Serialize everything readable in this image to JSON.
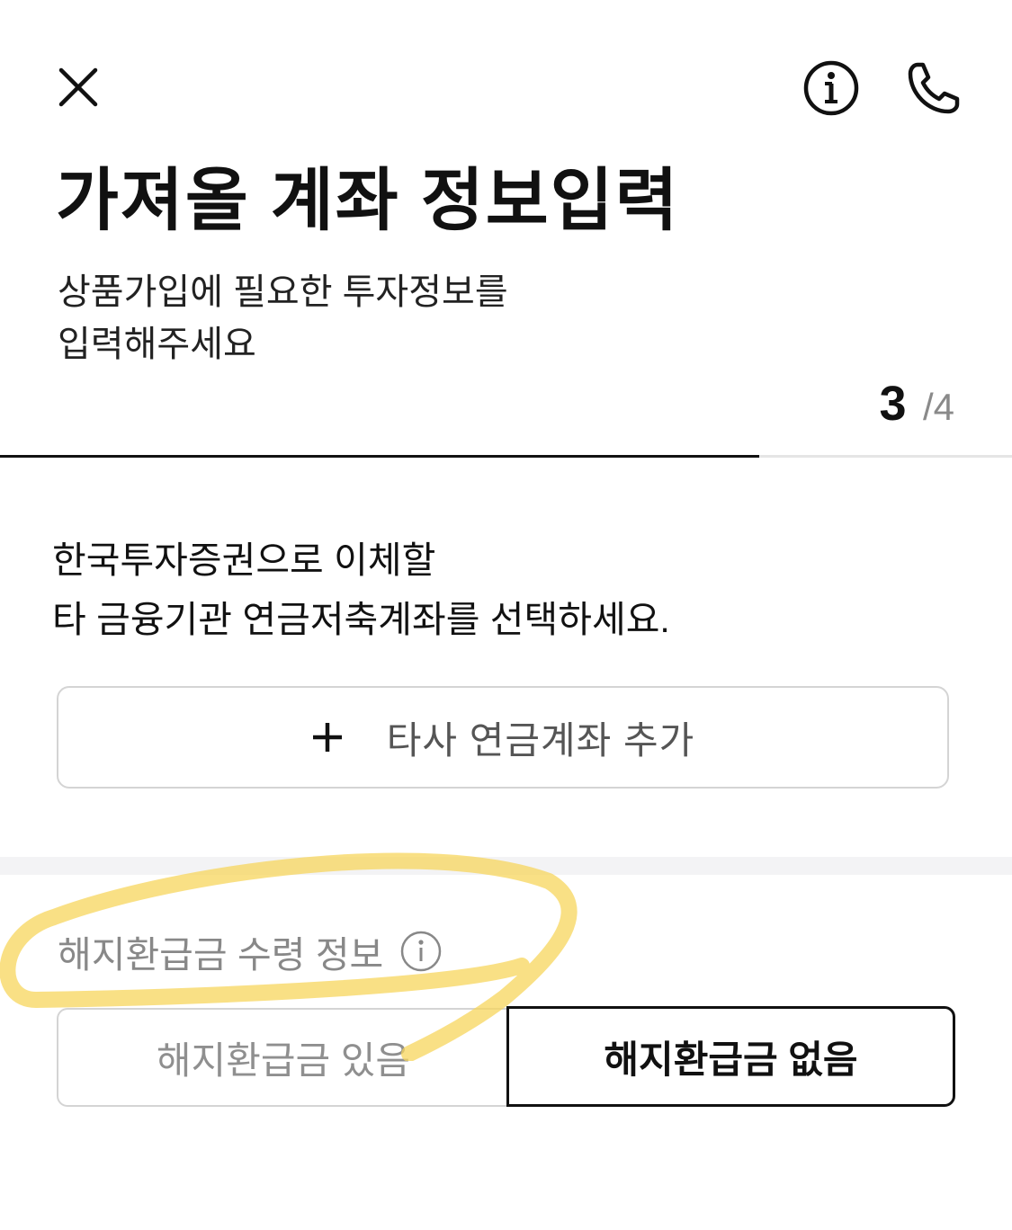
{
  "header": {
    "close_icon": "close-icon",
    "info_icon": "info-circle-icon",
    "phone_icon": "phone-icon"
  },
  "page": {
    "title": "가져올 계좌 정보입력",
    "subtitle_line1": "상품가입에 필요한 투자정보를",
    "subtitle_line2": "입력해주세요"
  },
  "stepper": {
    "current": "3",
    "separator": "/",
    "total": "4",
    "progress_fraction": 0.75
  },
  "instruction": {
    "line1": "한국투자증권으로 이체할",
    "line2": "타 금융기관 연금저축계좌를 선택하세요."
  },
  "add_account": {
    "label": "타사 연금계좌 추가",
    "icon": "plus-icon"
  },
  "refund_section": {
    "label": "해지환급금 수령 정보",
    "info_icon": "info-circle-icon",
    "option_yes": "해지환급금 있음",
    "option_no": "해지환급금 없음",
    "selected": "option_no"
  },
  "colors": {
    "text_primary": "#111111",
    "text_muted": "#888888",
    "border": "#d4d4d4",
    "highlight": "#f7d55c"
  }
}
